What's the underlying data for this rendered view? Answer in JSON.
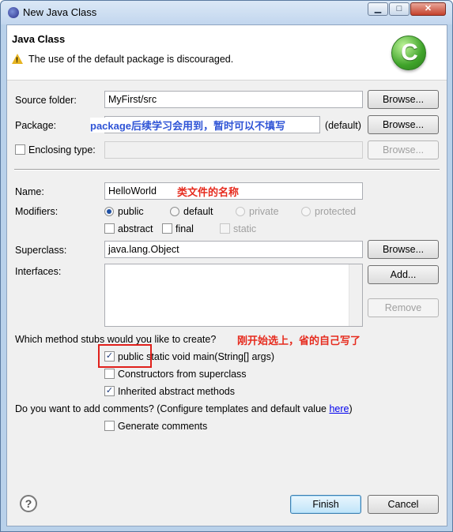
{
  "window": {
    "title": "New Java Class",
    "minimize": "▁",
    "maximize": "□",
    "close": "✕"
  },
  "banner": {
    "title": "Java Class",
    "message": "The use of the default package is discouraged.",
    "logo_letter": "C"
  },
  "form": {
    "source_folder": {
      "label": "Source folder:",
      "value": "MyFirst/src",
      "button": "Browse..."
    },
    "package": {
      "label": "Package:",
      "value": "",
      "default_text": "(default)",
      "button": "Browse...",
      "annotation": "package后续学习会用到，暂时可以不填写"
    },
    "enclosing": {
      "label": "Enclosing type:",
      "checked": false,
      "button": "Browse..."
    },
    "name": {
      "label": "Name:",
      "value": "HelloWorld",
      "annotation": "类文件的名称"
    },
    "modifiers": {
      "label": "Modifiers:",
      "radios": [
        "public",
        "default",
        "private",
        "protected"
      ],
      "checks": [
        "abstract",
        "final",
        "static"
      ]
    },
    "superclass": {
      "label": "Superclass:",
      "value": "java.lang.Object",
      "button": "Browse..."
    },
    "interfaces": {
      "label": "Interfaces:",
      "add_button": "Add...",
      "remove_button": "Remove"
    },
    "stubs": {
      "question": "Which method stubs would you like to create?",
      "annotation": "刚开始选上，省的自己写了",
      "main_public": "public",
      "main_rest": "static void main(String[] args)",
      "constructors": "Constructors from superclass",
      "inherited": "Inherited abstract methods"
    },
    "comments": {
      "question_prefix": "Do you want to add comments? (Configure templates and default value ",
      "link": "here",
      "question_suffix": ")",
      "generate": "Generate comments"
    }
  },
  "footer": {
    "help": "?",
    "finish": "Finish",
    "cancel": "Cancel"
  },
  "check_mark": "✓"
}
